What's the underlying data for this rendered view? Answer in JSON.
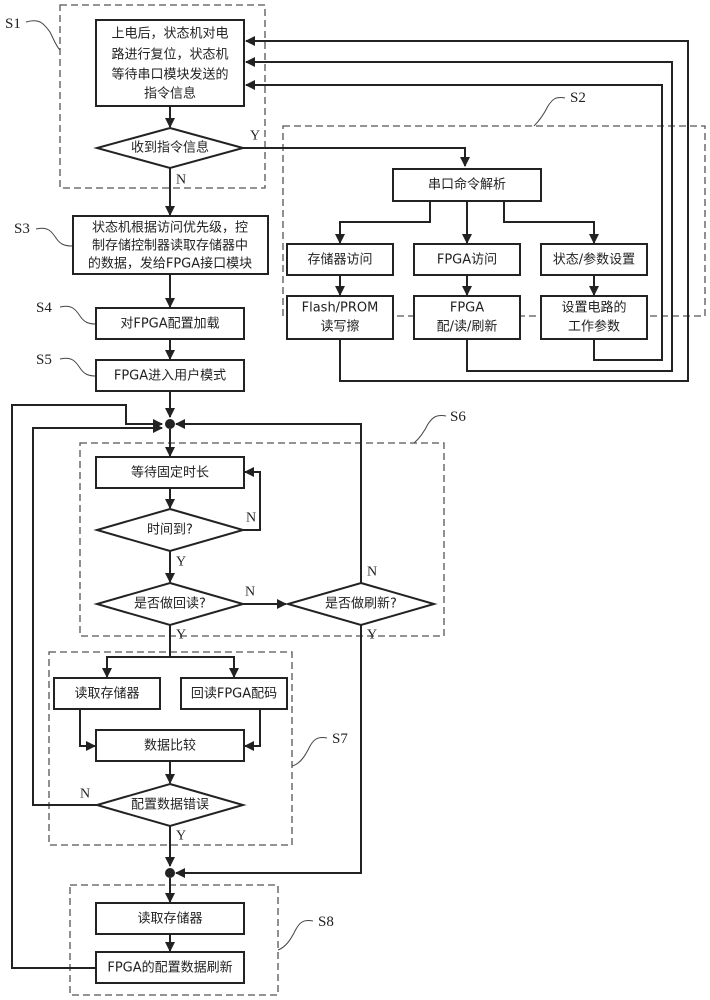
{
  "steps": {
    "S1": "S1",
    "S2": "S2",
    "S3": "S3",
    "S4": "S4",
    "S5": "S5",
    "S6": "S6",
    "S7": "S7",
    "S8": "S8"
  },
  "nodes": {
    "power_on": [
      "上电后，状态机对电",
      "路进行复位，状态机",
      "等待串口模块发送的",
      "指令信息"
    ],
    "received": "收到指令信息",
    "parse": "串口命令解析",
    "mem_access": "存储器访问",
    "fpga_access": "FPGA访问",
    "state_param": "状态/参数设置",
    "flash_rw": [
      "Flash/PROM",
      "读写擦"
    ],
    "fpga_cfg": [
      "FPGA",
      "配/读/刷新"
    ],
    "set_params": [
      "设置电路的",
      "工作参数"
    ],
    "read_priority": [
      "状态机根据访问优先级，控",
      "制存储控制器读取存储器中",
      "的数据，发给FPGA接口模块"
    ],
    "config_load": "对FPGA配置加载",
    "user_mode": "FPGA进入用户模式",
    "wait": "等待固定时长",
    "time_up": "时间到?",
    "readback_q": "是否做回读?",
    "refresh_q": "是否做刷新?",
    "read_mem": "读取存储器",
    "readback_fpga": "回读FPGA配码",
    "compare": "数据比较",
    "config_err": "配置数据错误",
    "read_mem2": "读取存储器",
    "refresh_data": "FPGA的配置数据刷新"
  },
  "branch": {
    "yes": "Y",
    "no": "N"
  }
}
